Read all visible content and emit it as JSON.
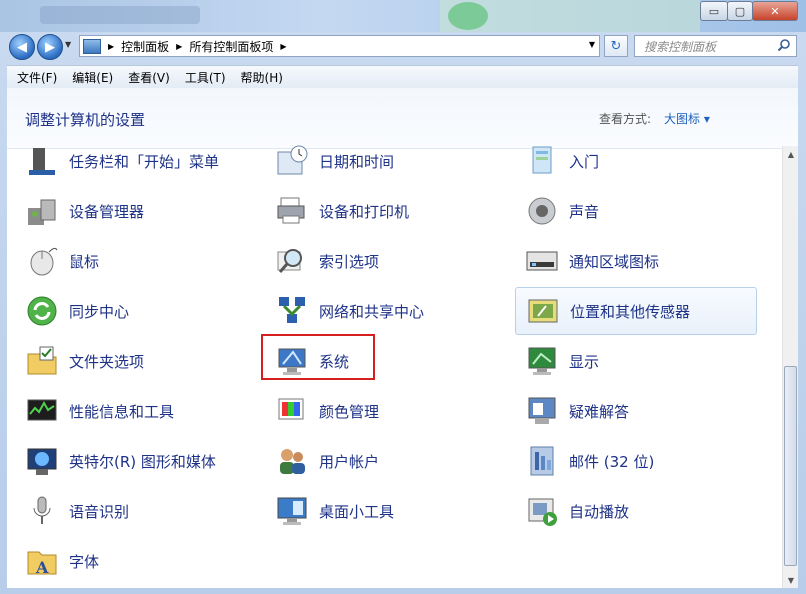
{
  "window": {
    "caption_buttons": {
      "minimize": "▭",
      "maximize": "▢",
      "close": "✕"
    }
  },
  "address_bar": {
    "back": "◀",
    "forward": "▶",
    "crumbs": [
      "控制面板",
      "所有控制面板项"
    ],
    "separator": "▶",
    "refresh": "↻",
    "search_placeholder": "搜索控制面板"
  },
  "menu": [
    "文件(F)",
    "编辑(E)",
    "查看(V)",
    "工具(T)",
    "帮助(H)"
  ],
  "header": {
    "title": "调整计算机的设置",
    "view_label": "查看方式:",
    "view_value": "大图标 ▾"
  },
  "items": [
    {
      "label": "任务栏和「开始」菜单",
      "icon": "taskbar-icon"
    },
    {
      "label": "日期和时间",
      "icon": "calendar-clock-icon"
    },
    {
      "label": "入门",
      "icon": "getting-started-icon"
    },
    {
      "label": "设备管理器",
      "icon": "device-manager-icon"
    },
    {
      "label": "设备和打印机",
      "icon": "printer-icon"
    },
    {
      "label": "声音",
      "icon": "speaker-icon"
    },
    {
      "label": "鼠标",
      "icon": "mouse-icon"
    },
    {
      "label": "索引选项",
      "icon": "magnifier-icon"
    },
    {
      "label": "通知区域图标",
      "icon": "notification-tray-icon"
    },
    {
      "label": "同步中心",
      "icon": "sync-icon"
    },
    {
      "label": "网络和共享中心",
      "icon": "network-icon"
    },
    {
      "label": "位置和其他传感器",
      "icon": "sensor-icon"
    },
    {
      "label": "文件夹选项",
      "icon": "folder-options-icon"
    },
    {
      "label": "系统",
      "icon": "system-icon"
    },
    {
      "label": "显示",
      "icon": "display-icon"
    },
    {
      "label": "性能信息和工具",
      "icon": "performance-icon"
    },
    {
      "label": "颜色管理",
      "icon": "color-management-icon"
    },
    {
      "label": "疑难解答",
      "icon": "troubleshooting-icon"
    },
    {
      "label": "英特尔(R) 图形和媒体",
      "icon": "intel-graphics-icon"
    },
    {
      "label": "用户帐户",
      "icon": "user-accounts-icon"
    },
    {
      "label": "邮件 (32 位)",
      "icon": "mail-icon"
    },
    {
      "label": "语音识别",
      "icon": "microphone-icon"
    },
    {
      "label": "桌面小工具",
      "icon": "gadgets-icon"
    },
    {
      "label": "自动播放",
      "icon": "autoplay-icon"
    },
    {
      "label": "字体",
      "icon": "fonts-icon"
    }
  ],
  "hover_item": "位置和其他传感器",
  "highlighted_item": "系统",
  "colors": {
    "link": "#1e3287",
    "highlight_border": "#d62020",
    "accent": "#1e5fbf"
  }
}
